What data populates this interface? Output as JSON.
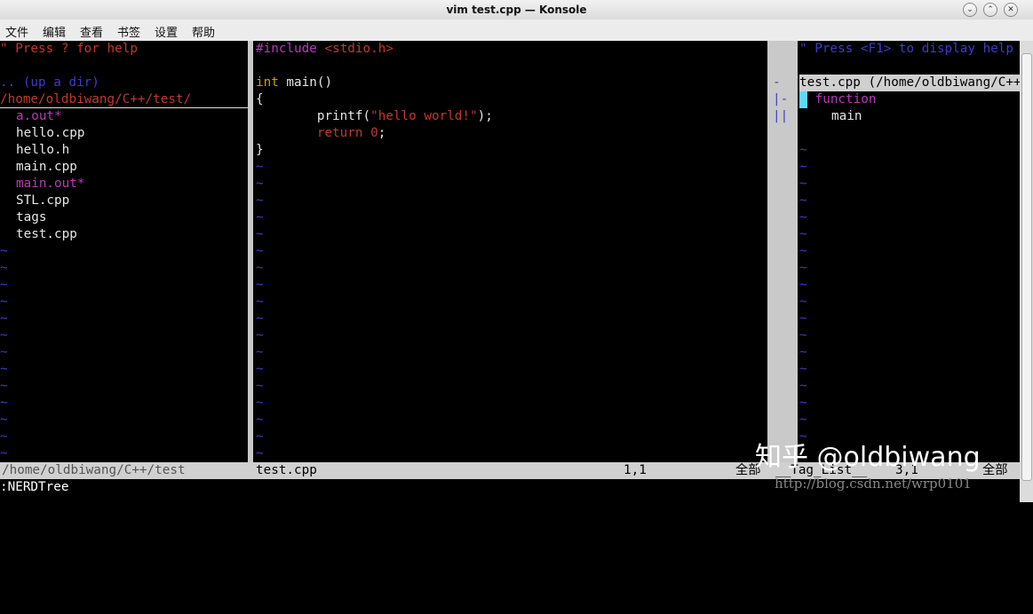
{
  "window": {
    "title": "vim test.cpp — Konsole"
  },
  "menu": [
    "文件",
    "编辑",
    "查看",
    "书签",
    "设置",
    "帮助"
  ],
  "nerdtree": {
    "help": "\" Press ? for help",
    "updir": ".. (up a dir)",
    "cwd": "/home/oldbiwang/C++/test/",
    "files": [
      {
        "name": "a.out*",
        "exec": true
      },
      {
        "name": "hello.cpp",
        "exec": false
      },
      {
        "name": "hello.h",
        "exec": false
      },
      {
        "name": "main.cpp",
        "exec": false
      },
      {
        "name": "main.out*",
        "exec": true
      },
      {
        "name": "STL.cpp",
        "exec": false
      },
      {
        "name": "tags",
        "exec": false
      },
      {
        "name": "test.cpp",
        "exec": false
      }
    ]
  },
  "editor": {
    "include_directive": "#include",
    "include_file": "<stdio.h>",
    "int_kw": "int",
    "main_sig": " main()",
    "open_brace": "{",
    "printf_call": "        printf(",
    "printf_str": "\"hello world!\"",
    "printf_end": ");",
    "return_kw": "        return",
    "return_val": "0",
    "return_end": ";",
    "close_brace": "}"
  },
  "taglist": {
    "help": "\" Press <F1> to display help",
    "file_entry": "test.cpp (/home/oldbiwang/C++/test/",
    "group": "function",
    "tag": "main",
    "fold_marks": [
      "-",
      "|-",
      "||"
    ]
  },
  "tilde": "~",
  "status": {
    "nerd_path": "/home/oldbiwang/C++/test",
    "file": "test.cpp",
    "pos": "1,1",
    "all": "全部",
    "tag_name": "__Tag_List__",
    "tag_pos": "3,1",
    "tag_all": "全部"
  },
  "command": ":NERDTree",
  "watermark": {
    "zhihu": "知乎 @oldbiwang",
    "csdn": "http://blog.csdn.net/wrp0101"
  }
}
